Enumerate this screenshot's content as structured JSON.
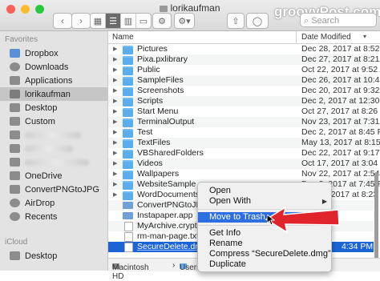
{
  "window": {
    "title": "lorikaufman",
    "watermark": "groovyPost.com",
    "search_placeholder": "Search",
    "back_label": "‹",
    "forward_label": "›"
  },
  "sidebar": {
    "favorites_header": "Favorites",
    "icloud_header": "iCloud",
    "items": [
      {
        "label": "Dropbox",
        "icon": "dropbox-icon"
      },
      {
        "label": "Downloads",
        "icon": "downloads-icon"
      },
      {
        "label": "Applications",
        "icon": "applications-icon"
      },
      {
        "label": "lorikaufman",
        "icon": "home-icon",
        "selected": true
      },
      {
        "label": "Desktop",
        "icon": "desktop-icon"
      },
      {
        "label": "Custom",
        "icon": "folder-icon"
      },
      {
        "label": "OneDrive",
        "icon": "folder-icon"
      },
      {
        "label": "ConvertPNGtoJPG",
        "icon": "folder-icon"
      },
      {
        "label": "AirDrop",
        "icon": "airdrop-icon"
      },
      {
        "label": "Recents",
        "icon": "recents-icon"
      }
    ],
    "icloud_items": [
      {
        "label": "Desktop",
        "icon": "desktop-icon"
      }
    ]
  },
  "columns": {
    "name": "Name",
    "date": "Date Modified"
  },
  "files": [
    {
      "name": "Pictures",
      "date": "Dec 28, 2017 at 8:52 PM",
      "type": "folder"
    },
    {
      "name": "Pixa.pxlibrary",
      "date": "Dec 27, 2017 at 8:21 PM",
      "type": "folder"
    },
    {
      "name": "Public",
      "date": "Oct 22, 2017 at 9:52 AM",
      "type": "folder"
    },
    {
      "name": "SampleFiles",
      "date": "Dec 26, 2017 at 10:41 PM",
      "type": "folder"
    },
    {
      "name": "Screenshots",
      "date": "Dec 20, 2017 at 9:32 PM",
      "type": "folder"
    },
    {
      "name": "Scripts",
      "date": "Dec 2, 2017 at 12:30 PM",
      "type": "folder"
    },
    {
      "name": "Start Menu",
      "date": "Oct 27, 2017 at 8:26 PM",
      "type": "folder"
    },
    {
      "name": "TerminalOutput",
      "date": "Nov 23, 2017 at 7:31 PM",
      "type": "folder"
    },
    {
      "name": "Test",
      "date": "Dec 2, 2017 at 8:45 PM",
      "type": "folder"
    },
    {
      "name": "TextFiles",
      "date": "May 13, 2017 at 8:15 PM",
      "type": "folder"
    },
    {
      "name": "VBSharedFolders",
      "date": "Dec 22, 2017 at 9:17 AM",
      "type": "folder"
    },
    {
      "name": "Videos",
      "date": "Oct 17, 2017 at 3:04 PM",
      "type": "folder"
    },
    {
      "name": "Wallpapers",
      "date": "Nov 22, 2017 at 2:54 PM",
      "type": "folder"
    },
    {
      "name": "WebsiteSample",
      "date": "Dec 2, 2017 at 7:45 PM",
      "type": "folder"
    },
    {
      "name": "WordDocuments",
      "date": "Oct 27, 2017 at 8:23 PM",
      "type": "folder"
    },
    {
      "name": "ConvertPNGtoJPG.app",
      "date": "",
      "type": "app"
    },
    {
      "name": "Instapaper.app",
      "date": "",
      "type": "app"
    },
    {
      "name": "MyArchive.crypto",
      "date": "",
      "type": "doc"
    },
    {
      "name": "rm-man-page.txt",
      "date": "",
      "type": "doc"
    },
    {
      "name": "SecureDelete.dmg",
      "date": "4:34 PM",
      "type": "doc",
      "selected": true
    }
  ],
  "context_menu": {
    "items": [
      "Open",
      "Open With",
      "Move to Trash",
      "Get Info",
      "Rename",
      "Compress “SecureDelete.dmg”",
      "Duplicate"
    ],
    "submenu_arrow": "▶"
  },
  "pathbar": {
    "drive": "Macintosh HD",
    "user": "Users"
  },
  "colors": {
    "selection": "#1c64d5",
    "menu_highlight": "#2d6fe2",
    "folder": "#5aaef0",
    "annotation_arrow": "#e0242b"
  }
}
